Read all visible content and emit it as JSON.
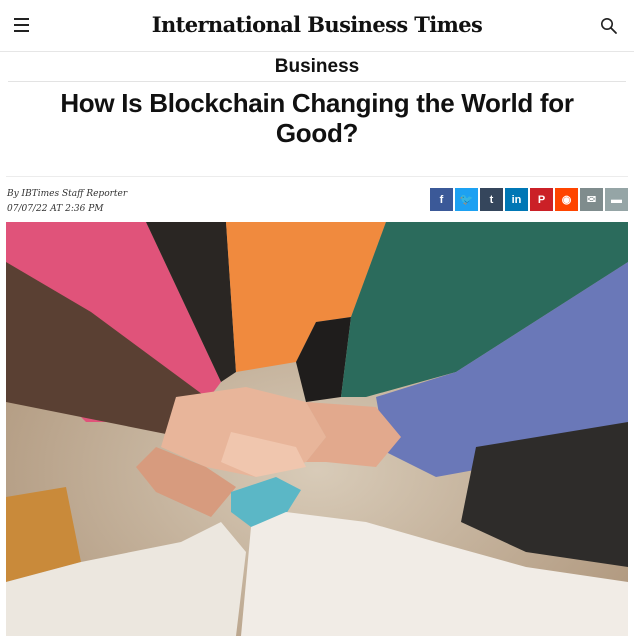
{
  "header": {
    "logo_text": "International Business Times",
    "menu_icon": "hamburger-menu-icon",
    "search_icon": "search-icon"
  },
  "article": {
    "section": "Business",
    "headline": "How Is Blockchain Changing the World for Good?",
    "author": "By IBTimes Staff Reporter",
    "date": "07/07/22 AT 2:36 PM"
  },
  "share": {
    "buttons": [
      {
        "icon": "facebook-icon",
        "glyph": "f",
        "color": "#3b5998"
      },
      {
        "icon": "twitter-icon",
        "glyph": "🐦",
        "color": "#1da1f2"
      },
      {
        "icon": "tumblr-icon",
        "glyph": "t",
        "color": "#35465c"
      },
      {
        "icon": "linkedin-icon",
        "glyph": "in",
        "color": "#0077b5"
      },
      {
        "icon": "pinterest-icon",
        "glyph": "P",
        "color": "#cb2027"
      },
      {
        "icon": "reddit-icon",
        "glyph": "◉",
        "color": "#ff4500"
      },
      {
        "icon": "email-icon",
        "glyph": "✉",
        "color": "#7f8c8d"
      },
      {
        "icon": "comment-icon",
        "glyph": "▬",
        "color": "#95a5a6"
      }
    ]
  },
  "image": {
    "subject": "hands-stacked-photo"
  }
}
